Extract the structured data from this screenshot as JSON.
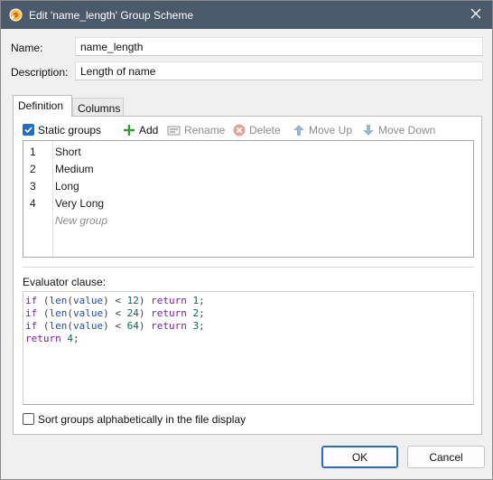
{
  "window": {
    "title": "Edit 'name_length' Group Scheme"
  },
  "form": {
    "name_label": "Name:",
    "name_value": "name_length",
    "description_label": "Description:",
    "description_value": "Length of name"
  },
  "tabs": [
    {
      "label": "Definition",
      "active": true
    },
    {
      "label": "Columns",
      "active": false
    }
  ],
  "toolbar": {
    "static_groups_label": "Static groups",
    "static_groups_checked": true,
    "add_label": "Add",
    "rename_label": "Rename",
    "delete_label": "Delete",
    "move_up_label": "Move Up",
    "move_down_label": "Move Down"
  },
  "groups": [
    {
      "index": "1",
      "name": "Short"
    },
    {
      "index": "2",
      "name": "Medium"
    },
    {
      "index": "3",
      "name": "Long"
    },
    {
      "index": "4",
      "name": "Very Long"
    }
  ],
  "new_group_placeholder": "New group",
  "evaluator": {
    "label": "Evaluator clause:",
    "code_lines": [
      "if (len(value) < 12) return 1;",
      "if (len(value) < 24) return 2;",
      "if (len(value) < 64) return 3;",
      "return 4;"
    ]
  },
  "sort_option": {
    "label": "Sort groups alphabetically in the file display",
    "checked": false
  },
  "buttons": {
    "ok_label": "OK",
    "cancel_label": "Cancel"
  },
  "colors": {
    "titlebar": "#4b5a6b",
    "accent": "#1f6fc7",
    "keyword": "#7a1fa8",
    "function": "#1f4fa8",
    "number": "#0b6b5a"
  }
}
